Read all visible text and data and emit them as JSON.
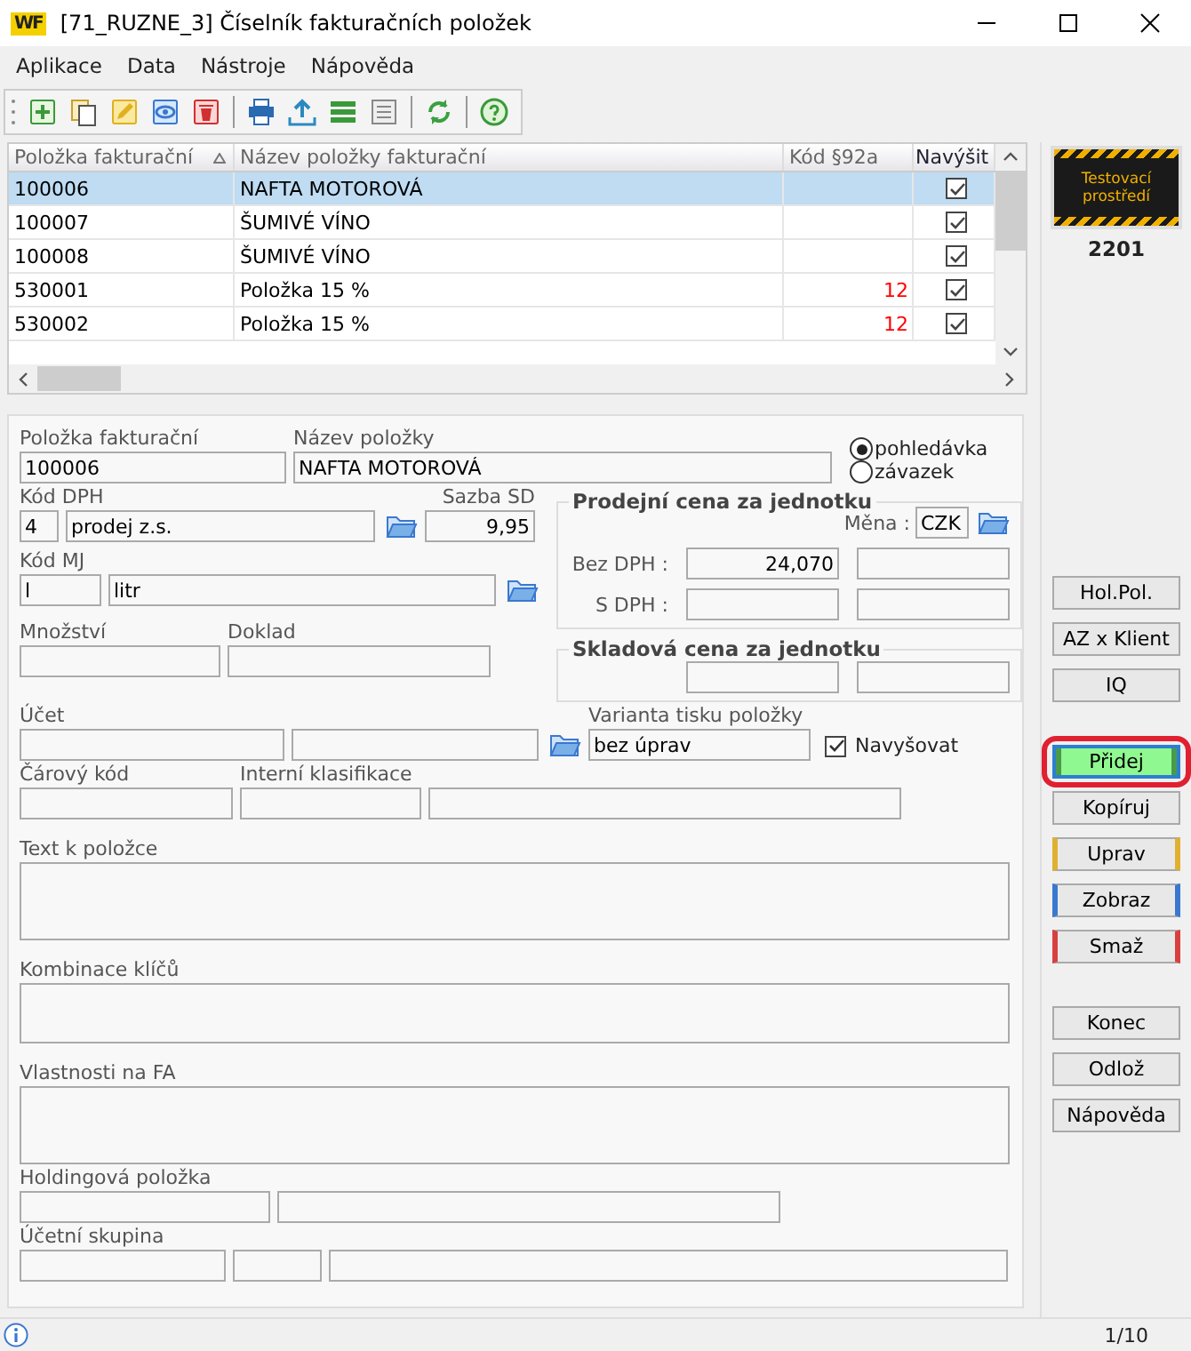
{
  "window": {
    "logo": "WF",
    "title": "[71_RUZNE_3] Číselník fakturačních položek"
  },
  "menu": [
    "Aplikace",
    "Data",
    "Nástroje",
    "Nápověda"
  ],
  "toolbar": [
    {
      "kind": "add"
    },
    {
      "kind": "copy"
    },
    {
      "kind": "edit"
    },
    {
      "kind": "view"
    },
    {
      "kind": "delete"
    },
    {
      "kind": "sep"
    },
    {
      "kind": "print"
    },
    {
      "kind": "export"
    },
    {
      "kind": "list"
    },
    {
      "kind": "columns"
    },
    {
      "kind": "sep"
    },
    {
      "kind": "refresh"
    },
    {
      "kind": "sep"
    },
    {
      "kind": "help"
    }
  ],
  "table": {
    "columns": [
      {
        "label": "Položka fakturační",
        "sorted": true
      },
      {
        "label": "Název položky fakturační",
        "sorted": false
      },
      {
        "label": "Kód §92a",
        "sorted": false
      },
      {
        "label": "Navýšit",
        "sorted": false
      }
    ],
    "rows": [
      {
        "code": "100006",
        "name": "NAFTA MOTOROVÁ",
        "code92a": "",
        "raise": true,
        "selected": true
      },
      {
        "code": "100007",
        "name": "ŠUMIVÉ VÍNO",
        "code92a": "",
        "raise": true,
        "selected": false
      },
      {
        "code": "100008",
        "name": "ŠUMIVÉ VÍNO",
        "code92a": "",
        "raise": true,
        "selected": false
      },
      {
        "code": "530001",
        "name": "Položka 15 %",
        "code92a": "12",
        "raise": true,
        "selected": false
      },
      {
        "code": "530002",
        "name": "Položka 15 %",
        "code92a": "12",
        "raise": true,
        "selected": false
      }
    ]
  },
  "form": {
    "item_code": {
      "label": "Položka fakturační",
      "value": "100006"
    },
    "item_name": {
      "label": "Název položky",
      "value": "NAFTA MOTOROVÁ"
    },
    "direction": [
      {
        "label": "pohledávka",
        "selected": true
      },
      {
        "label": "závazek",
        "selected": false
      }
    ],
    "vat_code": {
      "label": "Kód DPH",
      "code": "4",
      "name": "prodej z.s."
    },
    "rate": {
      "label": "Sazba SD",
      "value": "9,95"
    },
    "unit": {
      "label": "Kód MJ",
      "code": "l",
      "name": "litr"
    },
    "quantity": {
      "label": "Množství"
    },
    "document": {
      "label": "Doklad"
    },
    "sale_price": {
      "title": "Prodejní cena za jednotku",
      "currency_label": "Měna :",
      "currency": "CZK",
      "rows": [
        {
          "label": "Bez DPH :",
          "value": "24,070"
        },
        {
          "label": "S DPH :",
          "value": ""
        }
      ]
    },
    "stock_price": {
      "title": "Skladová cena za jednotku"
    },
    "account": {
      "label": "Účet"
    },
    "print_variant": {
      "label": "Varianta tisku položky",
      "value": "bez úprav"
    },
    "raise": {
      "label": "Navyšovat",
      "checked": true
    },
    "barcode": {
      "label": "Čárový kód"
    },
    "internal": {
      "label": "Interní klasifikace"
    },
    "areas": [
      {
        "label": "Text k položce"
      },
      {
        "label": "Kombinace klíčů"
      },
      {
        "label": "Vlastnosti na FA"
      }
    ],
    "holding": {
      "label": "Holdingová položka"
    },
    "group": {
      "label": "Účetní skupina"
    }
  },
  "side": {
    "badge": "Testovací prostředí",
    "number": "2201",
    "button_groups": [
      [
        {
          "label": "Hol.Pol.",
          "kind": "plain"
        },
        {
          "label": "AZ x Klient",
          "kind": "plain"
        },
        {
          "label": "IQ",
          "kind": "plain"
        }
      ],
      [
        {
          "label": "Přidej",
          "kind": "active",
          "highlighted": true
        },
        {
          "label": "Kopíruj",
          "kind": "plain"
        },
        {
          "label": "Uprav",
          "kind": "accent",
          "color": "#e0b030"
        },
        {
          "label": "Zobraz",
          "kind": "accent",
          "color": "#3a78d0"
        },
        {
          "label": "Smaž",
          "kind": "accent",
          "color": "#d84040"
        }
      ],
      [
        {
          "label": "Konec",
          "kind": "plain"
        },
        {
          "label": "Odlož",
          "kind": "plain"
        },
        {
          "label": "Nápověda",
          "kind": "plain"
        }
      ]
    ]
  },
  "status_bar": {
    "page": "1/10"
  }
}
